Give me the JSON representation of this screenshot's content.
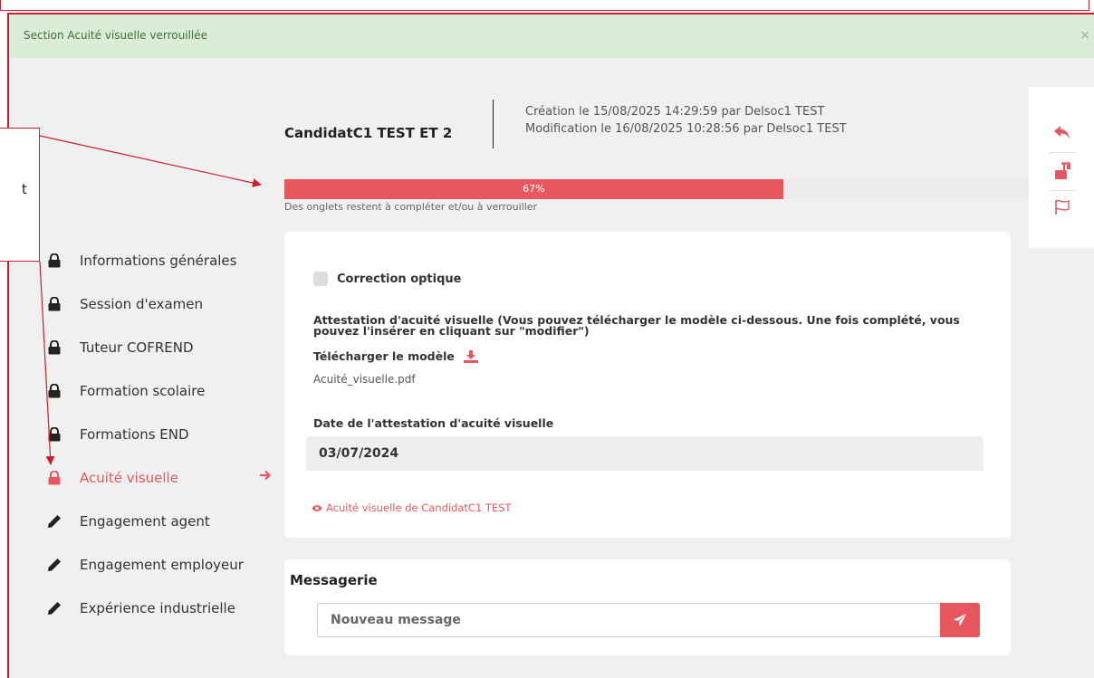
{
  "alert": {
    "text": "Section Acuité visuelle verrouillée",
    "close": "×"
  },
  "candidate": {
    "name": "CandidatC1 TEST ET 2",
    "created": "Création le 15/08/2025 14:29:59 par Delsoc1 TEST",
    "modified": "Modification le 16/08/2025 10:28:56 par Delsoc1 TEST"
  },
  "progress": {
    "value_percent": 67,
    "label": "67%",
    "note": "Des onglets restent à compléter et/ou à verrouiller"
  },
  "side_actions": [
    "back-arrow-icon",
    "unlock-icon",
    "flag-icon"
  ],
  "nav": {
    "items": [
      {
        "label": "Informations générales",
        "icon": "lock-icon"
      },
      {
        "label": "Session d'examen",
        "icon": "lock-icon"
      },
      {
        "label": "Tuteur COFREND",
        "icon": "lock-icon"
      },
      {
        "label": "Formation scolaire",
        "icon": "lock-icon"
      },
      {
        "label": "Formations END",
        "icon": "lock-icon"
      },
      {
        "label": "Acuité visuelle",
        "icon": "lock-icon",
        "active": true
      },
      {
        "label": "Engagement agent",
        "icon": "pencil-icon"
      },
      {
        "label": "Engagement employeur",
        "icon": "pencil-icon"
      },
      {
        "label": "Expérience industrielle",
        "icon": "pencil-icon"
      }
    ]
  },
  "form": {
    "correction_label": "Correction optique",
    "attestation_label": "Attestation d'acuité visuelle (Vous pouvez télécharger le modèle ci-dessous. Une fois complété, vous pouvez l'insérer en cliquant sur \"modifier\")",
    "download_label": "Télécharger le modèle",
    "file_name": "Acuité_visuelle.pdf",
    "date_label": "Date de l'attestation d'acuité visuelle",
    "date_value": "03/07/2024",
    "view_link": "Acuité visuelle de CandidatC1 TEST"
  },
  "messaging": {
    "title": "Messagerie",
    "placeholder": "Nouveau message"
  },
  "callout": {
    "text": "t"
  },
  "colors": {
    "accent": "#e85760",
    "annotation": "#cc1f2d",
    "alert_bg": "#dcedd7"
  }
}
